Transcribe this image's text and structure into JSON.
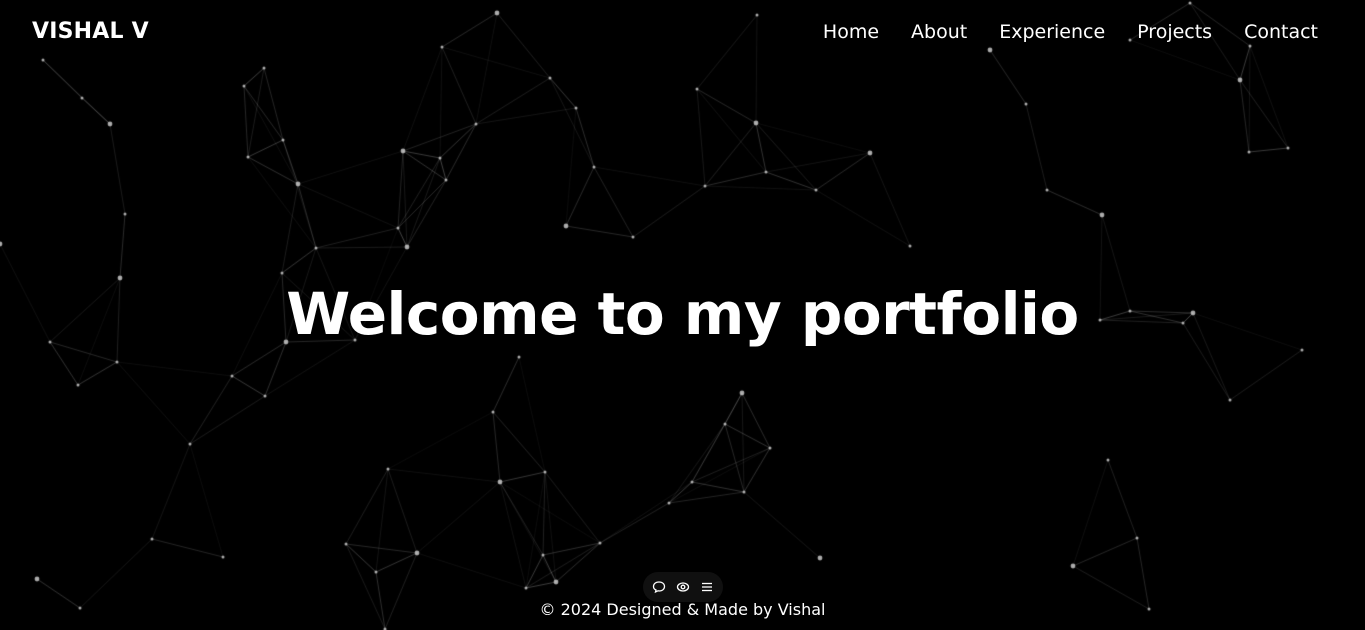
{
  "header": {
    "logo": "VISHAL V",
    "nav": [
      {
        "label": "Home"
      },
      {
        "label": "About"
      },
      {
        "label": "Experience"
      },
      {
        "label": "Projects"
      },
      {
        "label": "Contact"
      }
    ]
  },
  "hero": {
    "title": "Welcome to my portfolio"
  },
  "widget": {
    "icons": [
      "chat-bubble-icon",
      "eye-icon",
      "menu-icon"
    ]
  },
  "footer": {
    "text": "© 2024 Designed & Made by Vishal"
  },
  "colors": {
    "background": "#000000",
    "text": "#ffffff",
    "network_lines": "#ffffff"
  }
}
